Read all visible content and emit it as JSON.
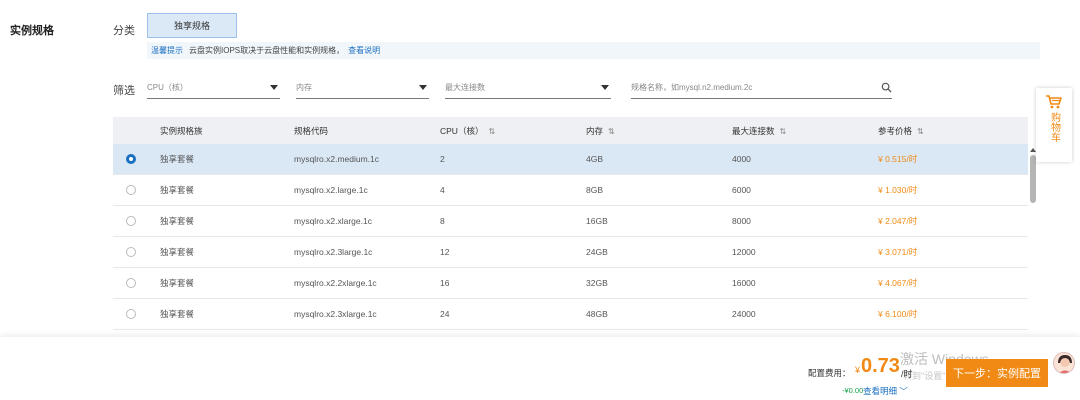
{
  "section": {
    "title": "实例规格"
  },
  "category": {
    "label": "分类",
    "chip": "独享规格"
  },
  "tip": {
    "tag": "温馨提示",
    "text": "云盘实例IOPS取决于云盘性能和实例规格，",
    "link": "查看说明"
  },
  "filter": {
    "label": "筛选",
    "cpu_placeholder": "CPU（核）",
    "memory_placeholder": "内存",
    "connections_placeholder": "最大连接数",
    "search_placeholder": "规格名称，如mysql.n2.medium.2c"
  },
  "table": {
    "headers": [
      "实例规格族",
      "规格代码",
      "CPU（核）",
      "内存",
      "最大连接数",
      "参考价格"
    ],
    "rows": [
      {
        "selected": true,
        "family": "独享套餐",
        "code": "mysqlro.x2.medium.1c",
        "cpu": "2",
        "memory": "4GB",
        "connections": "4000",
        "price": "¥ 0.515/时"
      },
      {
        "selected": false,
        "family": "独享套餐",
        "code": "mysqlro.x2.large.1c",
        "cpu": "4",
        "memory": "8GB",
        "connections": "6000",
        "price": "¥ 1.030/时"
      },
      {
        "selected": false,
        "family": "独享套餐",
        "code": "mysqlro.x2.xlarge.1c",
        "cpu": "8",
        "memory": "16GB",
        "connections": "8000",
        "price": "¥ 2.047/时"
      },
      {
        "selected": false,
        "family": "独享套餐",
        "code": "mysqlro.x2.3large.1c",
        "cpu": "12",
        "memory": "24GB",
        "connections": "12000",
        "price": "¥ 3.071/时"
      },
      {
        "selected": false,
        "family": "独享套餐",
        "code": "mysqlro.x2.2xlarge.1c",
        "cpu": "16",
        "memory": "32GB",
        "connections": "16000",
        "price": "¥ 4.067/时"
      },
      {
        "selected": false,
        "family": "独享套餐",
        "code": "mysqlro.x2.3xlarge.1c",
        "cpu": "24",
        "memory": "48GB",
        "connections": "24000",
        "price": "¥ 6.100/时"
      }
    ]
  },
  "cart": {
    "label": "购物车"
  },
  "footer": {
    "fee_label": "配置费用：",
    "currency": "¥",
    "amount": "0.73",
    "unit": "/时",
    "saving": "-¥0.00",
    "detail_link": "查看明细",
    "watermark": "激活 Windows",
    "watermark_sub": "转到\"设置\"",
    "next_button": "下一步：实例配置"
  },
  "colors": {
    "accent": "#f08a14",
    "link": "#1a6fbf",
    "selected_row": "#dae8f6",
    "saving": "#1aa34a"
  },
  "icons": {
    "sort": "sort-icon",
    "search": "search-icon",
    "cart": "cart-icon",
    "dropdown": "chevron-down-icon"
  }
}
